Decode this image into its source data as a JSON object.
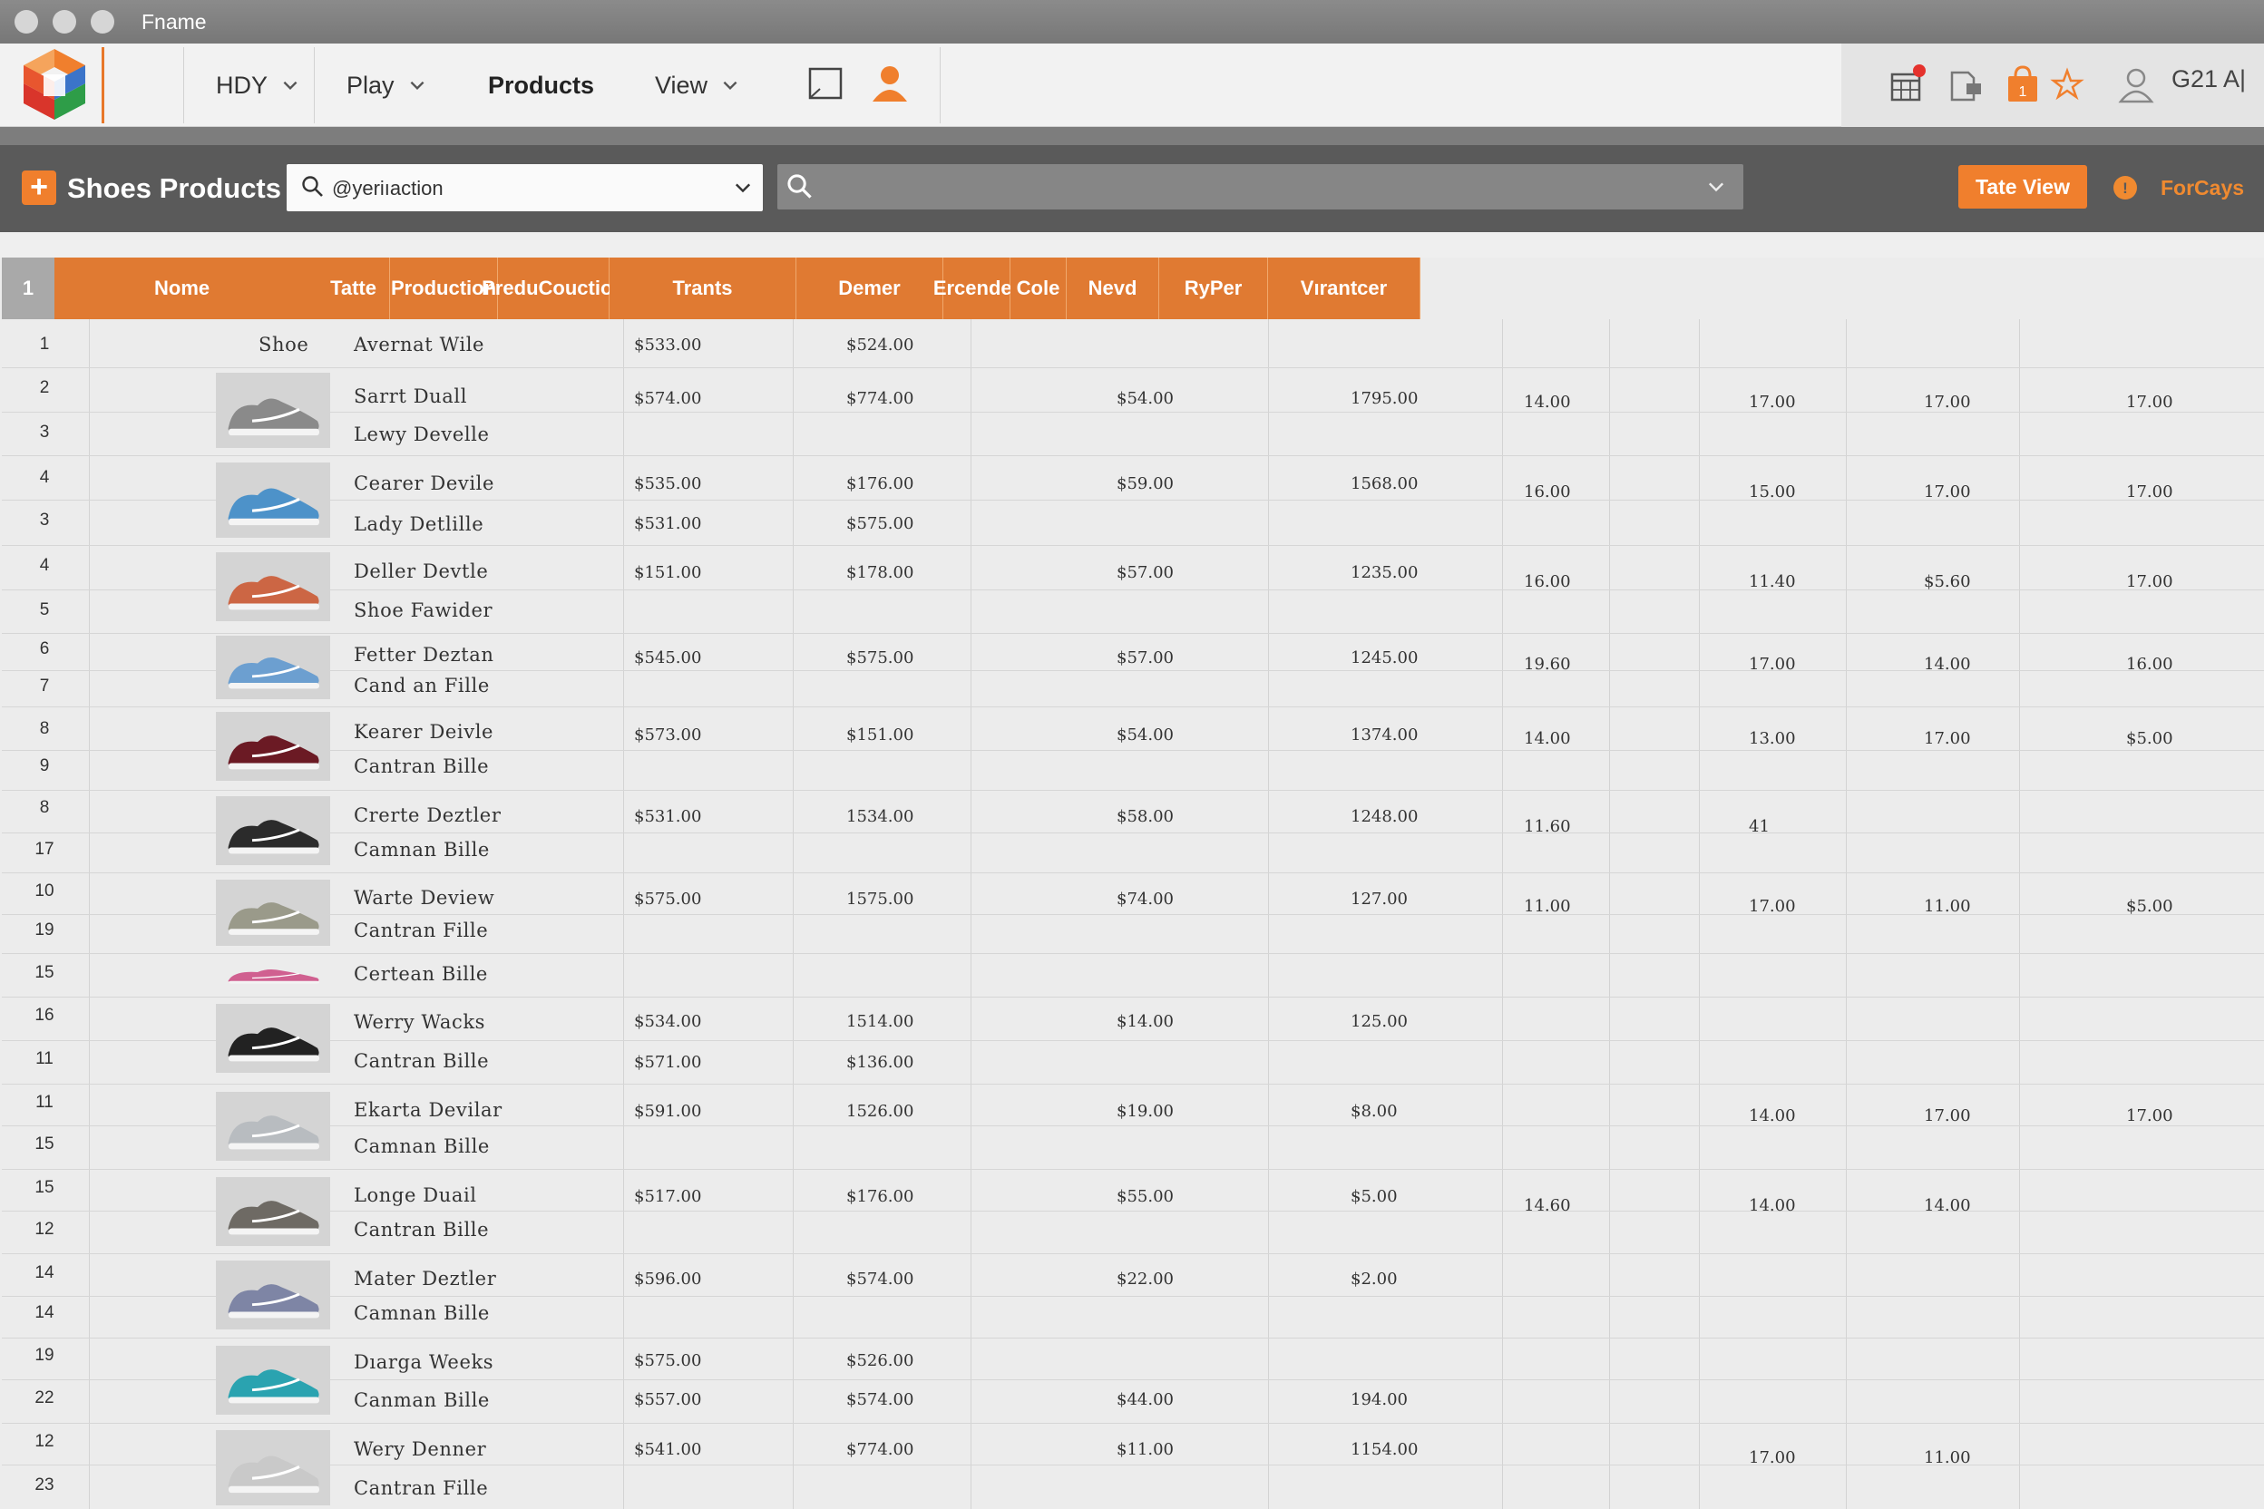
{
  "window": {
    "title": "Fname"
  },
  "toolbar": {
    "menus": [
      {
        "label": "HDY",
        "has_dropdown": true
      },
      {
        "label": "Play",
        "has_dropdown": true
      },
      {
        "label": "Products",
        "has_dropdown": false
      },
      {
        "label": "View",
        "has_dropdown": true
      }
    ],
    "user_label": "G21 A|",
    "notification_badge_color": "#e5322d",
    "accent_color": "#f07f2d"
  },
  "header_bar": {
    "title": "Shoes Products",
    "filter_value": "@yeriıaction",
    "search_value": "",
    "view_button": "Tate View",
    "forcays_label": "ForCays"
  },
  "table": {
    "corner_label": "1",
    "columns": [
      "Nome",
      "Tatte",
      "Production",
      "PreduCouction",
      "Trants",
      "Demer",
      "Ercender",
      "Cole",
      "Nevd",
      "RyPer",
      "Vırantcer"
    ],
    "rows": [
      {
        "num": "1",
        "name": "Avernat Wile",
        "shoe_label": "Shoe",
        "production": "$533.00",
        "preducouction": "$524.00"
      },
      {
        "num": "2",
        "name": "Sarrt Duall",
        "production": "$574.00",
        "preducouction": "$774.00",
        "trants": "$54.00",
        "demer": "1795.00"
      },
      {
        "num": "3",
        "name": "Lewy Develle"
      },
      {
        "num": "4",
        "name": "Cearer Devile",
        "production": "$535.00",
        "preducouction": "$176.00",
        "trants": "$59.00",
        "demer": "1568.00"
      },
      {
        "num": "3",
        "name": "Lady Detlille",
        "production": "$531.00",
        "preducouction": "$575.00"
      },
      {
        "num": "4",
        "name": "Deller Devtle",
        "production": "$151.00",
        "preducouction": "$178.00",
        "trants": "$57.00",
        "demer": "1235.00"
      },
      {
        "num": "5",
        "name": "Shoe Fawider"
      },
      {
        "num": "6",
        "name": "Fetter Deztan",
        "production": "$545.00",
        "preducouction": "$575.00",
        "trants": "$57.00",
        "demer": "1245.00"
      },
      {
        "num": "7",
        "name": "Cand an Fille"
      },
      {
        "num": "8",
        "name": "Kearer Deivle",
        "production": "$573.00",
        "preducouction": "$151.00",
        "trants": "$54.00",
        "demer": "1374.00"
      },
      {
        "num": "9",
        "name": "Cantran Bille"
      },
      {
        "num": "8",
        "name": "Crerte Deztler",
        "production": "$531.00",
        "preducouction": "1534.00",
        "trants": "$58.00",
        "demer": "1248.00"
      },
      {
        "num": "17",
        "name": "Camnan Bille"
      },
      {
        "num": "10",
        "name": "Warte Deview",
        "production": "$575.00",
        "preducouction": "1575.00",
        "trants": "$74.00",
        "demer": "127.00"
      },
      {
        "num": "19",
        "name": "Cantran Fille"
      },
      {
        "num": "15",
        "name": "Certean Bille"
      },
      {
        "num": "16",
        "name": "Werry Wacks",
        "production": "$534.00",
        "preducouction": "1514.00",
        "trants": "$14.00",
        "demer": "125.00"
      },
      {
        "num": "11",
        "name": "Cantran Bille",
        "production": "$571.00",
        "preducouction": "$136.00"
      },
      {
        "num": "11",
        "name": "Ekarta Devilar",
        "production": "$591.00",
        "preducouction": "1526.00",
        "trants": "$19.00",
        "demer": "$8.00"
      },
      {
        "num": "15",
        "name": "Camnan Bille"
      },
      {
        "num": "15",
        "name": "Longe Duail",
        "production": "$517.00",
        "preducouction": "$176.00",
        "trants": "$55.00",
        "demer": "$5.00"
      },
      {
        "num": "12",
        "name": "Cantran Bille"
      },
      {
        "num": "14",
        "name": "Mater Deztler",
        "production": "$596.00",
        "preducouction": "$574.00",
        "trants": "$22.00",
        "demer": "$2.00"
      },
      {
        "num": "14",
        "name": "Camnan Bille"
      },
      {
        "num": "19",
        "name": "Dıarga Weeks",
        "production": "$575.00",
        "preducouction": "$526.00"
      },
      {
        "num": "22",
        "name": "Canman Bille",
        "production": "$557.00",
        "preducouction": "$574.00",
        "trants": "$44.00",
        "demer": "194.00"
      },
      {
        "num": "12",
        "name": "Wery Denner",
        "production": "$541.00",
        "preducouction": "$774.00",
        "trants": "$11.00",
        "demer": "1154.00"
      },
      {
        "num": "23",
        "name": "Cantran Fille"
      }
    ],
    "group_values": [
      {
        "rows": "2-3",
        "ercender": "14.00",
        "nevd": "17.00",
        "ryper": "17.00",
        "virantcer": "17.00"
      },
      {
        "rows": "4-3",
        "ercender": "16.00",
        "nevd": "15.00",
        "ryper": "17.00",
        "virantcer": "17.00"
      },
      {
        "rows": "4-5",
        "ercender": "16.00",
        "nevd": "11.40",
        "ryper": "$5.60",
        "virantcer": "17.00"
      },
      {
        "rows": "6-7",
        "ercender": "19.60",
        "nevd": "17.00",
        "ryper": "14.00",
        "virantcer": "16.00"
      },
      {
        "rows": "8-9",
        "ercender": "14.00",
        "nevd": "13.00",
        "ryper": "17.00",
        "virantcer": "$5.00"
      },
      {
        "rows": "8-17",
        "ercender": "11.60",
        "nevd": "41"
      },
      {
        "rows": "10-19",
        "ercender": "11.00",
        "nevd": "17.00",
        "ryper": "11.00",
        "virantcer": "$5.00"
      },
      {
        "rows": "11-15",
        "nevd": "14.00",
        "ryper": "17.00",
        "virantcer": "17.00"
      },
      {
        "rows": "15-12",
        "ercender": "14.60",
        "nevd": "14.00",
        "ryper": "14.00"
      },
      {
        "rows": "12-23",
        "nevd": "17.00",
        "ryper": "11.00"
      }
    ],
    "shoe_thumbnails": [
      {
        "icon": "gray-white-high-top-sneaker-icon",
        "color": "#8a8a8a"
      },
      {
        "icon": "blue-yellow-sneaker-icon",
        "color": "#4d92c9"
      },
      {
        "icon": "orange-red-sneaker-icon",
        "color": "#cc6644"
      },
      {
        "icon": "light-blue-runner-icon",
        "color": "#6c9fd0"
      },
      {
        "icon": "maroon-runner-icon",
        "color": "#6b1a24"
      },
      {
        "icon": "black-white-runner-icon",
        "color": "#2b2b2b"
      },
      {
        "icon": "gray-runner-icon",
        "color": "#9a9a8a"
      },
      {
        "icon": "pink-sneaker-icon",
        "color": "#d06090"
      },
      {
        "icon": "black-red-runner-icon",
        "color": "#222222"
      },
      {
        "icon": "light-gray-runner-icon",
        "color": "#b8bcc0"
      },
      {
        "icon": "gray-canvas-sneaker-icon",
        "color": "#6e6a64"
      },
      {
        "icon": "lavender-high-top-icon",
        "color": "#7e85a5"
      },
      {
        "icon": "teal-runner-icon",
        "color": "#2aa3b0"
      },
      {
        "icon": "white-tan-sneaker-icon",
        "color": "#c9c9c9"
      }
    ]
  }
}
